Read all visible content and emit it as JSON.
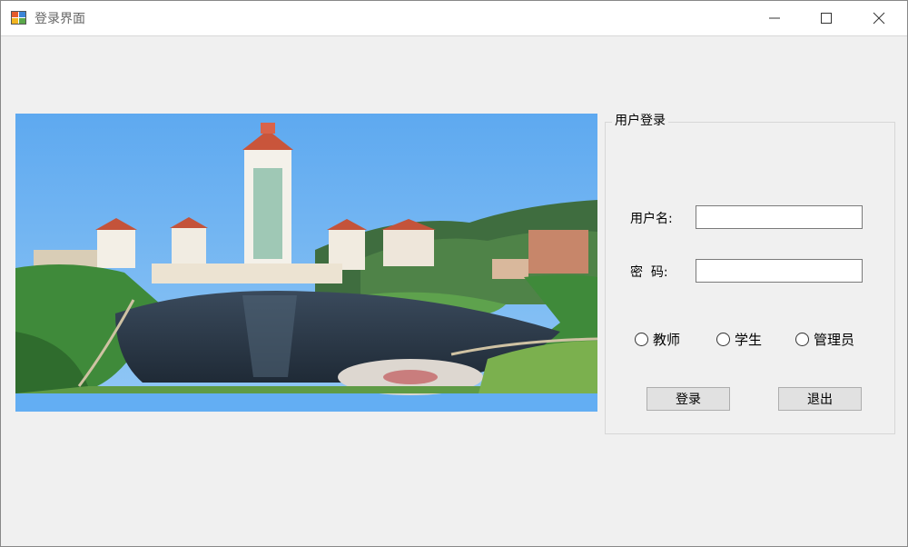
{
  "window": {
    "title": "登录界面",
    "app_icon": "windows-forms-app-icon",
    "controls": [
      "minimize-icon",
      "maximize-icon",
      "close-icon"
    ]
  },
  "banner": {
    "subject": "campus-photo-banner"
  },
  "login": {
    "group_title": "用户登录",
    "username_label": "用户名:",
    "username_value": "",
    "password_label": "密  码:",
    "password_value": "",
    "roles": [
      {
        "label": "教师",
        "selected": false
      },
      {
        "label": "学生",
        "selected": false
      },
      {
        "label": "管理员",
        "selected": false
      }
    ],
    "login_button": "登录",
    "exit_button": "退出"
  }
}
